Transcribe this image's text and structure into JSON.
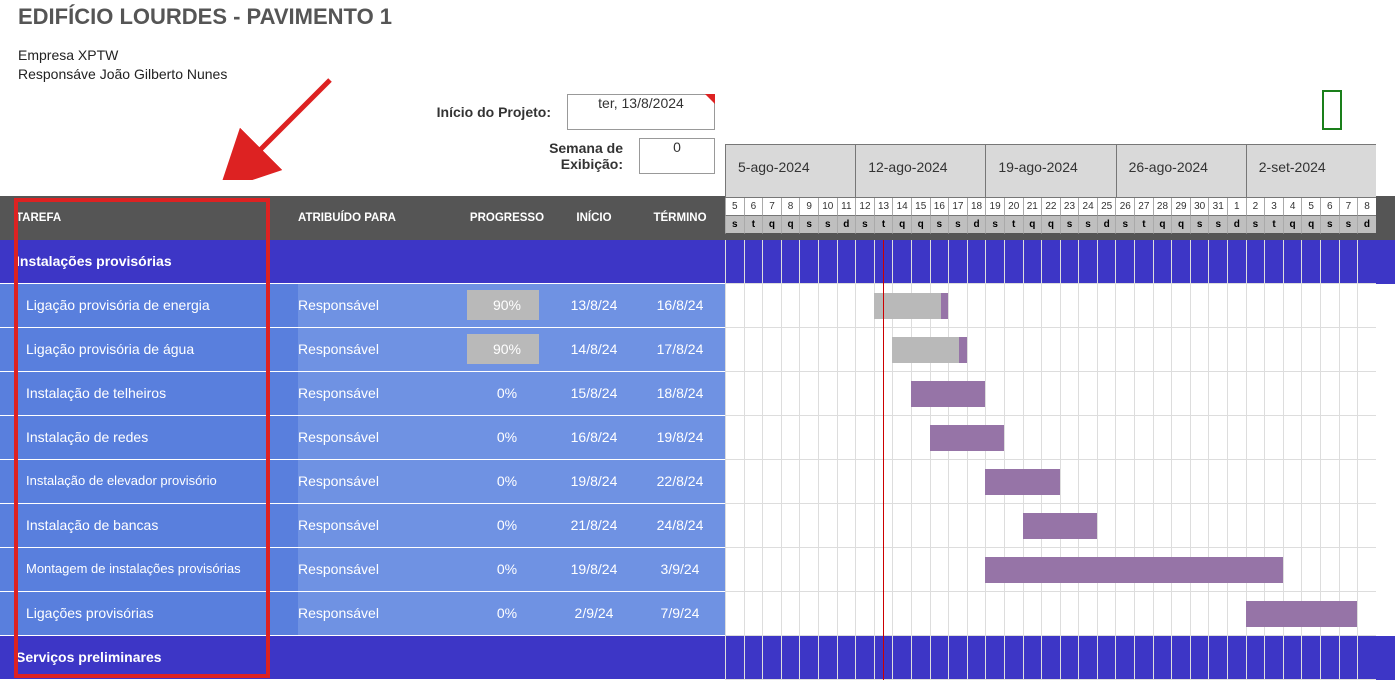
{
  "title": "EDIFÍCIO LOURDES - PAVIMENTO 1",
  "company_label": "Empresa",
  "company_value": "XPTW",
  "responsible_label": "Responsáve",
  "responsible_value": "João Gilberto Nunes",
  "project_start_label": "Início do Projeto:",
  "project_start_value": "ter, 13/8/2024",
  "display_week_label": "Semana de Exibição:",
  "display_week_value": "0",
  "headers": {
    "task": "TAREFA",
    "assigned": "ATRIBUÍDO PARA",
    "progress": "PROGRESSO",
    "start": "INÍCIO",
    "end": "TÉRMINO"
  },
  "weeks": [
    {
      "label": "5-ago-2024",
      "days": 7
    },
    {
      "label": "12-ago-2024",
      "days": 7
    },
    {
      "label": "19-ago-2024",
      "days": 7
    },
    {
      "label": "26-ago-2024",
      "days": 7
    },
    {
      "label": "2-set-2024",
      "days": 7
    }
  ],
  "day_numbers": [
    "5",
    "6",
    "7",
    "8",
    "9",
    "10",
    "11",
    "12",
    "13",
    "14",
    "15",
    "16",
    "17",
    "18",
    "19",
    "20",
    "21",
    "22",
    "23",
    "24",
    "25",
    "26",
    "27",
    "28",
    "29",
    "30",
    "31",
    "1",
    "2",
    "3",
    "4",
    "5",
    "6",
    "7",
    "8"
  ],
  "day_letters": [
    "s",
    "t",
    "q",
    "q",
    "s",
    "s",
    "d",
    "s",
    "t",
    "q",
    "q",
    "s",
    "s",
    "d",
    "s",
    "t",
    "q",
    "q",
    "s",
    "s",
    "d",
    "s",
    "t",
    "q",
    "q",
    "s",
    "s",
    "d",
    "s",
    "t",
    "q",
    "q",
    "s",
    "s",
    "d"
  ],
  "groups_and_tasks": [
    {
      "type": "group",
      "name": "Instalações provisórias"
    },
    {
      "type": "task",
      "name": "Ligação provisória de energia",
      "assigned": "Responsável",
      "progress": 90,
      "start": "13/8/24",
      "end": "16/8/24",
      "bar_start": 8,
      "bar_len": 4
    },
    {
      "type": "task",
      "name": "Ligação provisória de água",
      "assigned": "Responsável",
      "progress": 90,
      "start": "14/8/24",
      "end": "17/8/24",
      "bar_start": 9,
      "bar_len": 4
    },
    {
      "type": "task",
      "name": "Instalação de telheiros",
      "assigned": "Responsável",
      "progress": 0,
      "start": "15/8/24",
      "end": "18/8/24",
      "bar_start": 10,
      "bar_len": 4
    },
    {
      "type": "task",
      "name": "Instalação de redes",
      "assigned": "Responsável",
      "progress": 0,
      "start": "16/8/24",
      "end": "19/8/24",
      "bar_start": 11,
      "bar_len": 4
    },
    {
      "type": "task",
      "name": "Instalação de elevador provisório",
      "assigned": "Responsável",
      "progress": 0,
      "start": "19/8/24",
      "end": "22/8/24",
      "bar_start": 14,
      "bar_len": 4,
      "two": true
    },
    {
      "type": "task",
      "name": "Instalação de bancas",
      "assigned": "Responsável",
      "progress": 0,
      "start": "21/8/24",
      "end": "24/8/24",
      "bar_start": 16,
      "bar_len": 4
    },
    {
      "type": "task",
      "name": "Montagem de instalações provisórias",
      "assigned": "Responsável",
      "progress": 0,
      "start": "19/8/24",
      "end": "3/9/24",
      "bar_start": 14,
      "bar_len": 16,
      "two": true
    },
    {
      "type": "task",
      "name": "Ligações provisórias",
      "assigned": "Responsável",
      "progress": 0,
      "start": "2/9/24",
      "end": "7/9/24",
      "bar_start": 28,
      "bar_len": 6
    },
    {
      "type": "group",
      "name": "Serviços preliminares"
    }
  ],
  "today_index": 9,
  "chart_data": {
    "type": "gantt",
    "title": "EDIFÍCIO LOURDES - PAVIMENTO 1",
    "x_start": "2024-08-05",
    "x_end": "2024-09-08",
    "today": "2024-08-13",
    "series": [
      {
        "name": "Ligação provisória de energia",
        "start": "2024-08-13",
        "end": "2024-08-16",
        "progress": 0.9
      },
      {
        "name": "Ligação provisória de água",
        "start": "2024-08-14",
        "end": "2024-08-17",
        "progress": 0.9
      },
      {
        "name": "Instalação de telheiros",
        "start": "2024-08-15",
        "end": "2024-08-18",
        "progress": 0.0
      },
      {
        "name": "Instalação de redes",
        "start": "2024-08-16",
        "end": "2024-08-19",
        "progress": 0.0
      },
      {
        "name": "Instalação de elevador provisório",
        "start": "2024-08-19",
        "end": "2024-08-22",
        "progress": 0.0
      },
      {
        "name": "Instalação de bancas",
        "start": "2024-08-21",
        "end": "2024-08-24",
        "progress": 0.0
      },
      {
        "name": "Montagem de instalações provisórias",
        "start": "2024-08-19",
        "end": "2024-09-03",
        "progress": 0.0
      },
      {
        "name": "Ligações provisórias",
        "start": "2024-09-02",
        "end": "2024-09-07",
        "progress": 0.0
      }
    ]
  }
}
